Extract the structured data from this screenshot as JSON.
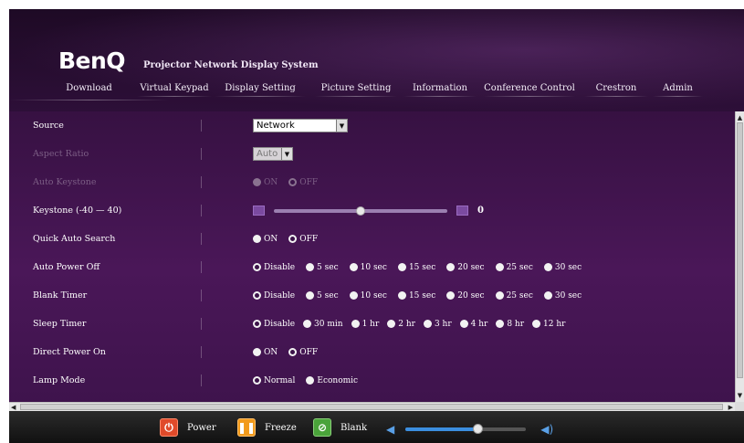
{
  "header": {
    "brand": "BenQ",
    "subtitle": "Projector Network Display System"
  },
  "nav": {
    "tabs": [
      {
        "label": "Download"
      },
      {
        "label": "Virtual Keypad"
      },
      {
        "label": "Display Setting"
      },
      {
        "label": "Picture Setting"
      },
      {
        "label": "Information"
      },
      {
        "label": "Conference Control"
      },
      {
        "label": "Crestron"
      },
      {
        "label": "Admin"
      }
    ]
  },
  "settings": {
    "source": {
      "label": "Source",
      "value": "Network"
    },
    "aspect_ratio": {
      "label": "Aspect Ratio",
      "value": "Auto"
    },
    "auto_keystone": {
      "label": "Auto Keystone",
      "options": [
        "ON",
        "OFF"
      ],
      "selected": "OFF"
    },
    "keystone": {
      "label": "Keystone (-40 — 40)",
      "value": "0",
      "level": 0,
      "min": -40,
      "max": 40
    },
    "quick_auto_search": {
      "label": "Quick Auto Search",
      "options": [
        "ON",
        "OFF"
      ],
      "selected": "OFF"
    },
    "auto_power_off": {
      "label": "Auto Power Off",
      "options": [
        "Disable",
        "5 sec",
        "10 sec",
        "15 sec",
        "20 sec",
        "25 sec",
        "30 sec"
      ],
      "selected": "Disable"
    },
    "blank_timer": {
      "label": "Blank Timer",
      "options": [
        "Disable",
        "5 sec",
        "10 sec",
        "15 sec",
        "20 sec",
        "25 sec",
        "30 sec"
      ],
      "selected": "Disable"
    },
    "sleep_timer": {
      "label": "Sleep Timer",
      "options": [
        "Disable",
        "30 min",
        "1 hr",
        "2 hr",
        "3 hr",
        "4 hr",
        "8 hr",
        "12 hr"
      ],
      "selected": "Disable"
    },
    "direct_power_on": {
      "label": "Direct Power On",
      "options": [
        "ON",
        "OFF"
      ],
      "selected": "OFF"
    },
    "lamp_mode": {
      "label": "Lamp Mode",
      "options": [
        "Normal",
        "Economic"
      ],
      "selected": "Normal"
    }
  },
  "bottom": {
    "power_label": "Power",
    "freeze_label": "Freeze",
    "blank_label": "Blank",
    "volume_level": 0.6
  },
  "colors": {
    "background": "#3a1246",
    "power": "#e04a2a",
    "freeze": "#f29a1c",
    "blank": "#4aa33a",
    "volume": "#3b8ee0"
  }
}
